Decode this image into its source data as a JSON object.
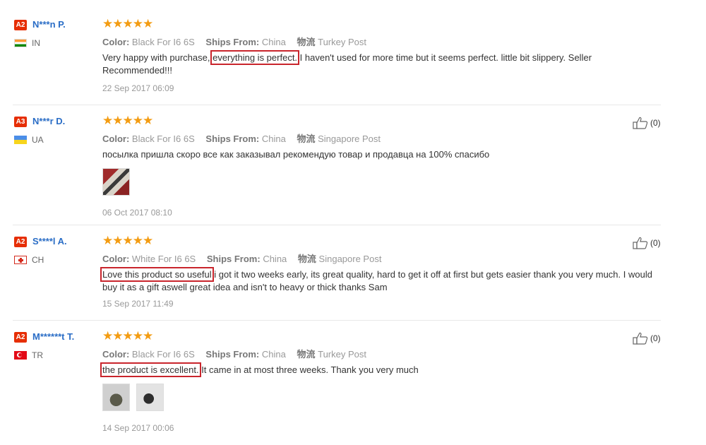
{
  "labels": {
    "color": "Color:",
    "ships_from": "Ships From:",
    "logistics": "物流"
  },
  "reviews": [
    {
      "badge": "A2",
      "name": "N***n P.",
      "country": "IN",
      "stars": "★★★★★",
      "color": "Black For I6 6S",
      "ships_from": "China",
      "shipping": "Turkey Post",
      "text_pre": "Very happy with purchase, ",
      "text_hl": "everything is perfect.",
      "text_post": " I haven't used for more time but it seems perfect. little bit slippery. Seller Recommended!!!",
      "date": "22 Sep 2017 06:09"
    },
    {
      "badge": "A3",
      "name": "N***r D.",
      "country": "UA",
      "stars": "★★★★★",
      "color": "Black For I6 6S",
      "ships_from": "China",
      "shipping": "Singapore Post",
      "text_pre": "посылка пришла скоро все как заказывал рекомендую товар и продавца на 100% спасибо",
      "text_hl": "",
      "text_post": "",
      "date": "06 Oct 2017 08:10",
      "helpful": "(0)"
    },
    {
      "badge": "A2",
      "name": "S****l A.",
      "country": "CH",
      "stars": "★★★★★",
      "color": "White For I6 6S",
      "ships_from": "China",
      "shipping": "Singapore Post",
      "text_pre": "",
      "text_hl": "Love this product so useful",
      "text_post": " i got it two weeks early, its great quality, hard to get it off at first but gets easier thank you very much. I would buy it as a gift aswell great idea and isn't to heavy or thick thanks Sam",
      "date": "15 Sep 2017 11:49",
      "helpful": "(0)"
    },
    {
      "badge": "A2",
      "name": "M******t T.",
      "country": "TR",
      "stars": "★★★★★",
      "color": "Black For I6 6S",
      "ships_from": "China",
      "shipping": "Turkey Post",
      "text_pre": "",
      "text_hl": "the product is excellent.",
      "text_post": " It came in at most three weeks. Thank you very much",
      "date": "14 Sep 2017 00:06",
      "helpful": "(0)"
    }
  ]
}
